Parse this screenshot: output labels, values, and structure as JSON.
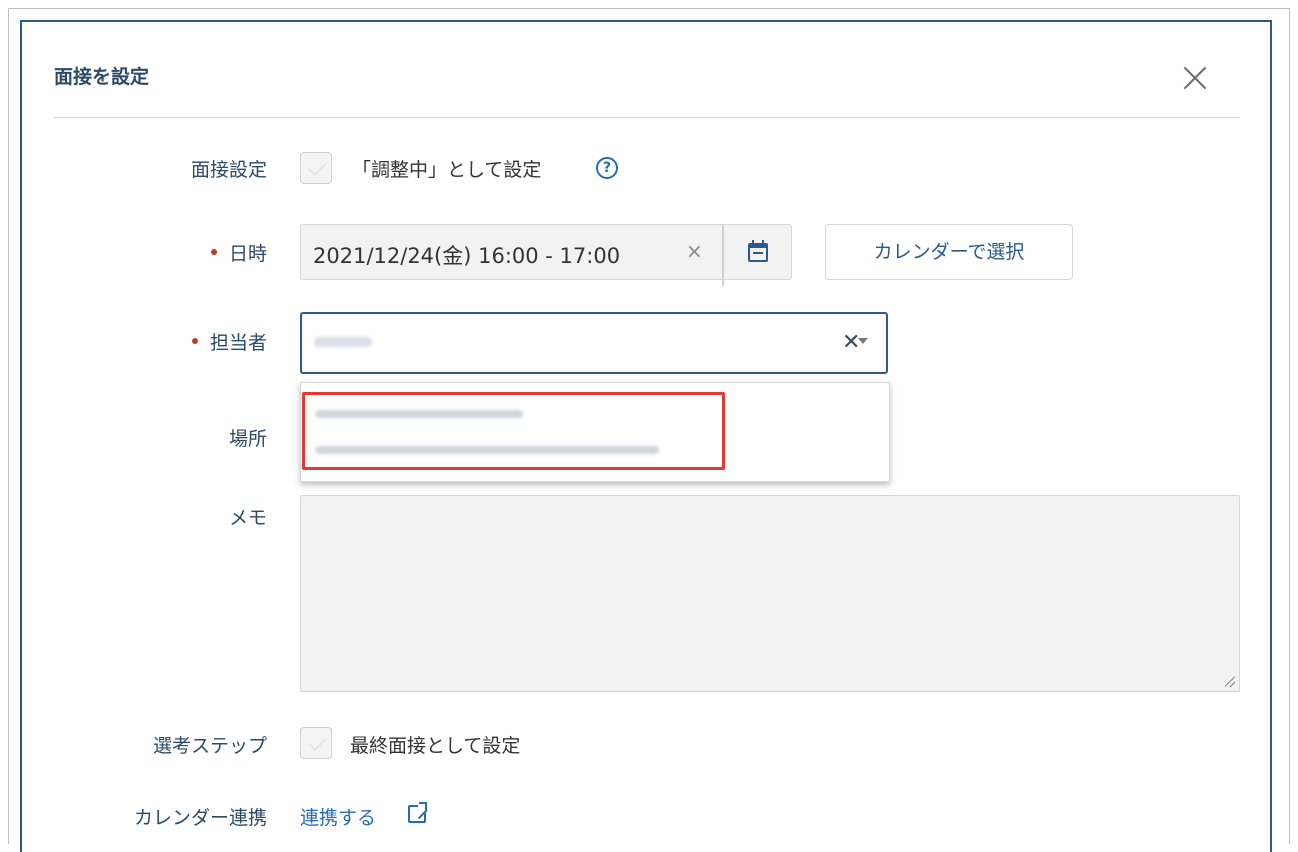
{
  "modal": {
    "title": "面接を設定",
    "close_icon": "close-icon"
  },
  "form": {
    "interview_setting": {
      "label": "面接設定",
      "checkbox_checked": false,
      "checkbox_label": "「調整中」として設定",
      "help_icon": "question-circle-icon",
      "help_glyph": "?"
    },
    "datetime": {
      "label": "日時",
      "required": true,
      "value": "2021/12/24(金) 16:00 - 17:00",
      "clear_glyph": "×",
      "calendar_icon": "calendar-icon",
      "calendar_button_label": "カレンダーで選択"
    },
    "assignee": {
      "label": "担当者",
      "required": true,
      "clear_glyph": "✕",
      "dropdown_icon": "caret-down-icon"
    },
    "location": {
      "label": "場所"
    },
    "memo": {
      "label": "メモ",
      "value": ""
    },
    "selection_step": {
      "label": "選考ステップ",
      "checkbox_checked": false,
      "checkbox_label": "最終面接として設定"
    },
    "calendar_link": {
      "label": "カレンダー連携",
      "link_label": "連携する",
      "link_icon": "external-link-icon"
    }
  },
  "colors": {
    "modal_border": "#2f5a83",
    "label_text": "#2c4a66",
    "link": "#2a6cb0",
    "required_dot": "#c0392b",
    "highlight": "#e53935"
  }
}
